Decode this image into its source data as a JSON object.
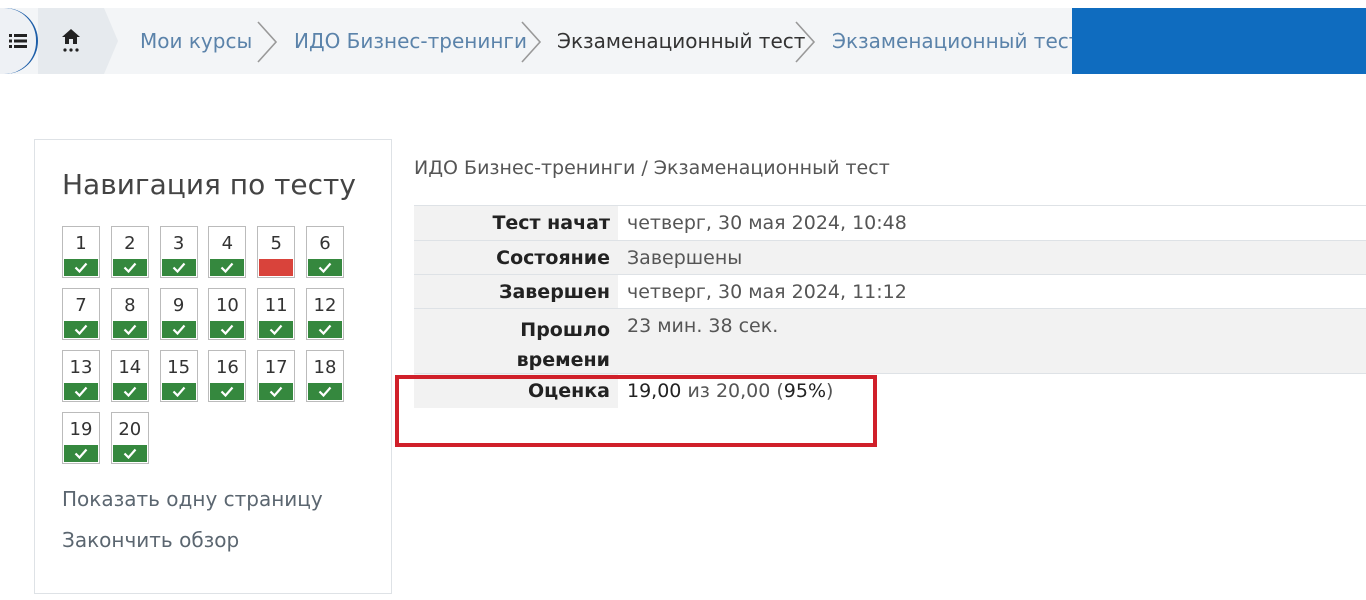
{
  "breadcrumb": {
    "items": [
      {
        "label": "Мои курсы"
      },
      {
        "label": "ИДО Бизнес-тренинги"
      },
      {
        "label": "Экзаменационный тест"
      },
      {
        "label": "Экзаменационный тест"
      }
    ]
  },
  "quiz_nav": {
    "title": "Навигация по тесту",
    "questions": [
      {
        "num": "1",
        "state": "correct"
      },
      {
        "num": "2",
        "state": "correct"
      },
      {
        "num": "3",
        "state": "correct"
      },
      {
        "num": "4",
        "state": "correct"
      },
      {
        "num": "5",
        "state": "incorrect"
      },
      {
        "num": "6",
        "state": "correct"
      },
      {
        "num": "7",
        "state": "correct"
      },
      {
        "num": "8",
        "state": "correct"
      },
      {
        "num": "9",
        "state": "correct"
      },
      {
        "num": "10",
        "state": "correct"
      },
      {
        "num": "11",
        "state": "correct"
      },
      {
        "num": "12",
        "state": "correct"
      },
      {
        "num": "13",
        "state": "correct"
      },
      {
        "num": "14",
        "state": "correct"
      },
      {
        "num": "15",
        "state": "correct"
      },
      {
        "num": "16",
        "state": "correct"
      },
      {
        "num": "17",
        "state": "correct"
      },
      {
        "num": "18",
        "state": "correct"
      },
      {
        "num": "19",
        "state": "correct"
      },
      {
        "num": "20",
        "state": "correct"
      }
    ],
    "show_one_page": "Показать одну страницу",
    "finish_review": "Закончить обзор"
  },
  "summary": {
    "breadcrumb": "ИДО Бизнес-тренинги  /  Экзаменационный тест",
    "rows": [
      {
        "label": "Тест начат",
        "value": "четверг, 30 мая 2024, 10:48"
      },
      {
        "label": "Состояние",
        "value": "Завершены"
      },
      {
        "label": "Завершен",
        "value": "четверг, 30 мая 2024, 11:12"
      },
      {
        "label_line1": "Прошло",
        "label_line2": "времени",
        "value": "23 мин. 38 сек."
      },
      {
        "label": "Оценка",
        "score": "19,00",
        "of": "из 20,00 (",
        "percent": "95%",
        "close": ")"
      }
    ]
  },
  "colors": {
    "accent": "#0f6cbf",
    "correct": "#35883e",
    "incorrect": "#d9433b",
    "highlight_box": "#d0202a"
  }
}
